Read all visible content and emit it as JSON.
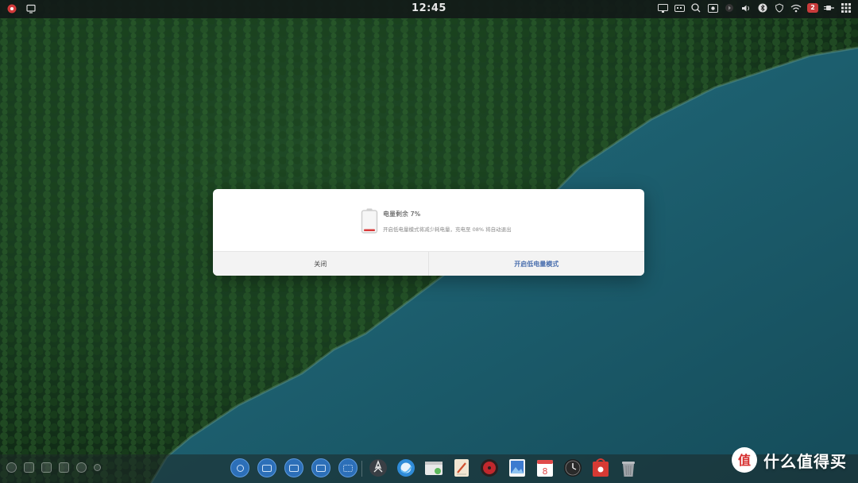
{
  "topbar": {
    "time": "12:45",
    "notification_count": "2",
    "left_icons": [
      "deepin-logo-icon",
      "screen-icon"
    ],
    "right_icons": [
      "display-icon",
      "keyboard-icon",
      "search-icon",
      "screen-record-icon",
      "media-icon",
      "volume-icon",
      "bluetooth-icon",
      "shield-icon",
      "wifi-icon",
      "notification-icon",
      "power-plug-icon",
      "launcher-grid-icon"
    ]
  },
  "dialog": {
    "title": "电量剩余 7%",
    "description": "开启低电量模式将减少耗电量，充电至 08% 将自动退出",
    "close_button": "关闭",
    "low_power_button": "开启低电量模式",
    "battery_level": 0.07,
    "colors": {
      "battery_fill": "#d93a3a",
      "primary_text": "#4a6fae"
    }
  },
  "dock": {
    "tray_icons": [
      "tray-item-1",
      "tray-item-2",
      "tray-item-3",
      "tray-item-4",
      "tray-item-5",
      "tray-item-6"
    ],
    "workspaces": [
      "workspace-1",
      "workspace-2",
      "workspace-3",
      "workspace-4",
      "workspace-5"
    ],
    "apps": [
      {
        "name": "multitasking-app",
        "icon": "rocket-icon"
      },
      {
        "name": "browser-app",
        "icon": "browser-icon"
      },
      {
        "name": "file-manager-app",
        "icon": "folder-icon"
      },
      {
        "name": "text-editor-app",
        "icon": "pen-icon"
      },
      {
        "name": "music-app",
        "icon": "music-icon"
      },
      {
        "name": "image-viewer-app",
        "icon": "image-icon"
      },
      {
        "name": "calendar-app",
        "icon": "calendar-icon",
        "label": "8"
      },
      {
        "name": "clock-app",
        "icon": "clock-icon"
      },
      {
        "name": "app-store-app",
        "icon": "store-icon"
      },
      {
        "name": "trash-app",
        "icon": "trash-icon"
      }
    ]
  },
  "watermark": {
    "text": "什么值得买",
    "logo_text": "值"
  }
}
